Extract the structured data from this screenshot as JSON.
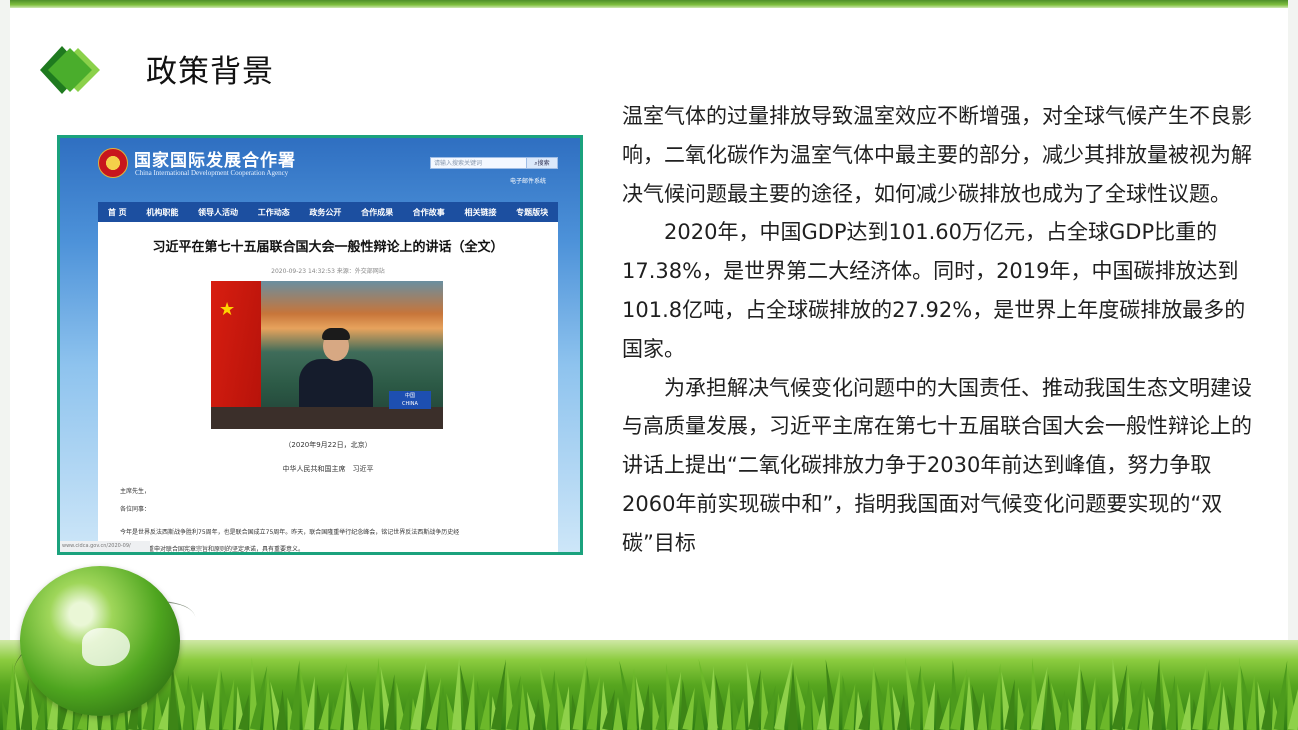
{
  "title": "政策背景",
  "screenshot": {
    "site_name": "国家国际发展合作署",
    "site_name_en": "China International Development Cooperation Agency",
    "search_placeholder": "请输入搜索关键词",
    "search_button": "搜索",
    "mail_link": "电子邮件系统",
    "nav": [
      "首  页",
      "机构职能",
      "领导人活动",
      "工作动态",
      "政务公开",
      "合作成果",
      "合作故事",
      "相关链接",
      "专题版块"
    ],
    "article": {
      "title": "习近平在第七十五届联合国大会一般性辩论上的讲话（全文）",
      "meta": "2020-09-23 14:32:53    来源：外交部网站",
      "nameplate": "中国\nCHINA",
      "caption": "（2020年9月22日，北京）",
      "byline": "中华人民共和国主席　习近平",
      "paragraphs": [
        "主席先生，",
        "各位同事：",
        "今年是世界反法西斯战争胜利75周年，也是联合国成立75周年。昨天，联合国隆重举行纪念峰会，铭记世界反法西斯战争历史经",
        "重申对联合国宪章宗旨和原则的坚定承诺，具有重要意义。"
      ],
      "url": "www.cidca.gov.cn/2020-09/"
    }
  },
  "body_text": [
    "温室气体的过量排放导致温室效应不断增强，对全球气候产生不良影响，二氧化碳作为温室气体中最主要的部分，减少其排放量被视为解决气候问题最主要的途径，如何减少碳排放也成为了全球性议题。",
    "2020年，中国GDP达到101.60万亿元，占全球GDP比重的17.38%，是世界第二大经济体。同时，2019年，中国碳排放达到101.8亿吨，占全球碳排放的27.92%，是世界上年度碳排放最多的国家。",
    "为承担解决气候变化问题中的大国责任、推动我国生态文明建设与高质量发展，习近平主席在第七十五届联合国大会一般性辩论上的讲话上提出“二氧化碳排放力争于2030年前达到峰值，努力争取2060年前实现碳中和”，指明我国面对气候变化问题要实现的“双碳”目标"
  ],
  "colors": {
    "accent_green": "#2e9a2a",
    "frame_teal": "#1ba27d",
    "nav_blue": "#1c4fa0"
  },
  "icons": {
    "title_logo": "green-diamond-icon",
    "decor": "green-globe-icon"
  }
}
